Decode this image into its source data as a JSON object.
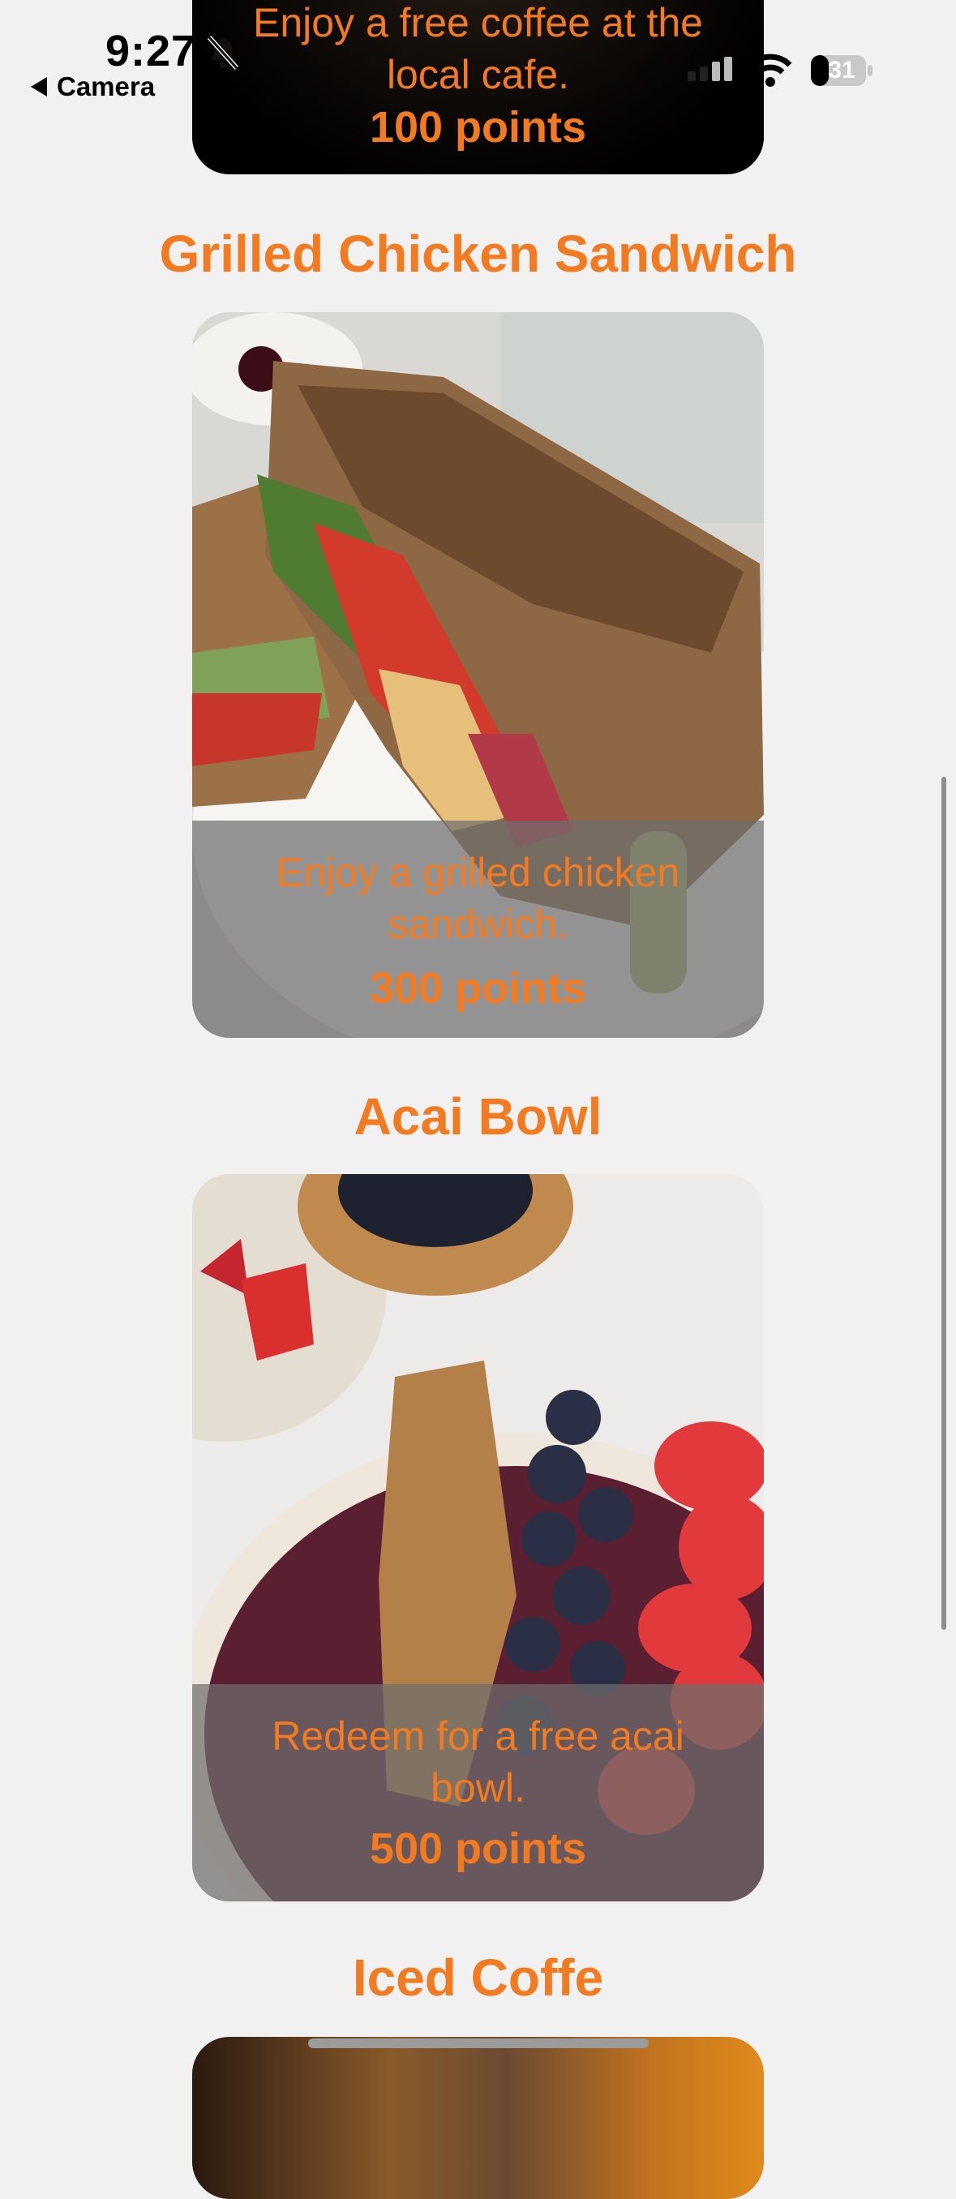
{
  "status_bar": {
    "time": "9:27",
    "back_label": "Camera",
    "battery": "31"
  },
  "rewards": [
    {
      "title": "",
      "description": "Enjoy a free coffee at the local cafe.",
      "points": "100 points"
    },
    {
      "title": "Grilled Chicken Sandwich",
      "description": "Enjoy a grilled chicken sandwich.",
      "points": "300 points"
    },
    {
      "title": "Acai Bowl",
      "description": "Redeem for a free acai bowl.",
      "points": "500 points"
    },
    {
      "title": "Iced Coffe",
      "description": "",
      "points": ""
    }
  ],
  "colors": {
    "accent": "#f27a20",
    "background": "#f2f1f1"
  }
}
